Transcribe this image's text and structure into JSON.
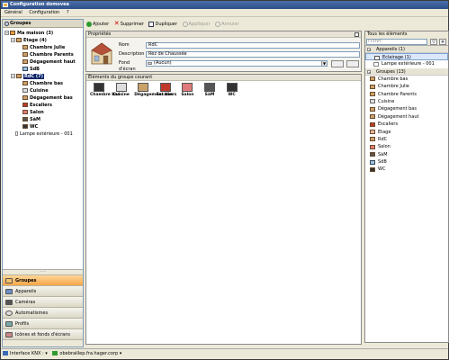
{
  "window": {
    "title": "Configuration domovea"
  },
  "menu": [
    "Général",
    "Configuration",
    "?"
  ],
  "left_panel": {
    "title": "Groupes",
    "tree": [
      {
        "label": "Ma maison (3)",
        "level": 0,
        "toggle": "−"
      },
      {
        "label": "Etage (4)",
        "level": 1,
        "toggle": "−"
      },
      {
        "label": "Chambre Julie",
        "level": 2
      },
      {
        "label": "Chambre Parents",
        "level": 2
      },
      {
        "label": "Dégagement haut",
        "level": 2
      },
      {
        "label": "SdB",
        "level": 2
      },
      {
        "label": "RdC (7)",
        "level": 1,
        "toggle": "−",
        "selected": true
      },
      {
        "label": "Chambre bas",
        "level": 2
      },
      {
        "label": "Cuisine",
        "level": 2
      },
      {
        "label": "Dégagement bas",
        "level": 2
      },
      {
        "label": "Escaliers",
        "level": 2
      },
      {
        "label": "Salon",
        "level": 2
      },
      {
        "label": "SàM",
        "level": 2
      },
      {
        "label": "WC",
        "level": 2
      },
      {
        "label": "Lampe extérieure - 001",
        "level": 1,
        "light": true
      }
    ],
    "nav": [
      {
        "label": "Groupes",
        "active": true
      },
      {
        "label": "Appareils"
      },
      {
        "label": "Caméras"
      },
      {
        "label": "Automatismes"
      },
      {
        "label": "Profils"
      },
      {
        "label": "Icônes et fonds d'écrans"
      }
    ]
  },
  "toolbar": {
    "add": "Ajouter",
    "delete": "Supprimer",
    "duplicate": "Dupliquer",
    "apply": "Appliquer",
    "cancel": "Annuler"
  },
  "properties": {
    "title": "Propriétés",
    "name_label": "Nom",
    "name_value": "RdC",
    "description_label": "Description",
    "description_value": "Rez de Chaussée",
    "background_label": "Fond d'écran",
    "background_value": "(Aucun)"
  },
  "group_elements": {
    "title": "Éléments du groupe courant",
    "items": [
      "Chambre bas",
      "Cuisine",
      "Dégagement bas",
      "Escaliers",
      "Salon",
      "SàM",
      "WC"
    ]
  },
  "right_panel": {
    "title": "Tous les éléments",
    "filter_placeholder": "Filtrer",
    "devices_section": "Appareils (1)",
    "devices": [
      {
        "label": "Eclairage (1)",
        "selected": true
      },
      {
        "label": "Lampe extérieure - 001"
      }
    ],
    "groups_section": "Groupes (13)",
    "groups": [
      "Chambre bas",
      "Chambre Julie",
      "Chambre Parents",
      "Cuisine",
      "Dégagement bas",
      "Dégagement haut",
      "Escaliers",
      "Etage",
      "RdC",
      "Salon",
      "SàM",
      "SdB",
      "WC"
    ]
  },
  "statusbar": {
    "interface": "Interface KNX :",
    "server": "obebraillep.fra.hager.corp"
  }
}
